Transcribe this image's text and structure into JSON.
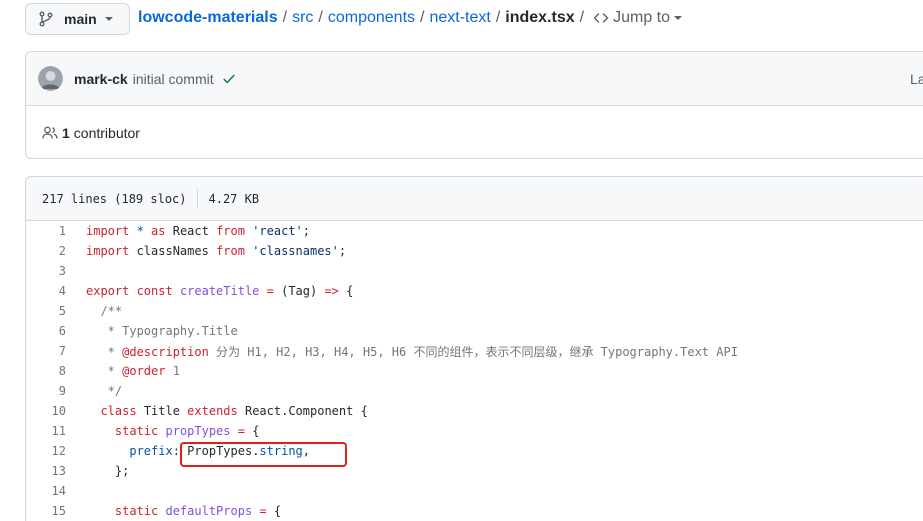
{
  "branch": {
    "label": "main",
    "icon": "git-branch-icon"
  },
  "breadcrumb": {
    "repo": "lowcode-materials",
    "parts": [
      "src",
      "components",
      "next-text"
    ],
    "file": "index.tsx",
    "separator": "/",
    "jump_label": "Jump to"
  },
  "commit": {
    "author": "mark-ck",
    "message": "initial commit",
    "status": "success",
    "latest_label": "La"
  },
  "contributors": {
    "count": "1",
    "label": "contributor"
  },
  "file_info": {
    "lines": "217 lines (189 sloc)",
    "size": "4.27 KB"
  },
  "code_lines": [
    {
      "n": "1",
      "t": [
        [
          "kw",
          "import "
        ],
        [
          "cst",
          "* "
        ],
        [
          "kw",
          "as "
        ],
        [
          "",
          "React "
        ],
        [
          "kw",
          "from "
        ],
        [
          "str",
          "'react'"
        ],
        [
          "",
          ";"
        ]
      ]
    },
    {
      "n": "2",
      "t": [
        [
          "kw",
          "import "
        ],
        [
          "",
          "classNames "
        ],
        [
          "kw",
          "from "
        ],
        [
          "str",
          "'classnames'"
        ],
        [
          "",
          ";"
        ]
      ]
    },
    {
      "n": "3",
      "t": []
    },
    {
      "n": "4",
      "t": [
        [
          "kw",
          "export "
        ],
        [
          "kw",
          "const "
        ],
        [
          "fn",
          "createTitle "
        ],
        [
          "kw",
          "= "
        ],
        [
          "",
          "(Tag) "
        ],
        [
          "kw",
          "=> "
        ],
        [
          "",
          "{"
        ]
      ]
    },
    {
      "n": "5",
      "t": [
        [
          "cm",
          "  /**"
        ]
      ]
    },
    {
      "n": "6",
      "t": [
        [
          "cm",
          "   * Typography.Title"
        ]
      ]
    },
    {
      "n": "7",
      "t": [
        [
          "cm",
          "   * "
        ],
        [
          "at",
          "@description "
        ],
        [
          "cm",
          "分为 H1, H2, H3, H4, H5, H6 不同的组件，表示不同层级，继承 Typography.Text API"
        ]
      ]
    },
    {
      "n": "8",
      "t": [
        [
          "cm",
          "   * "
        ],
        [
          "at",
          "@order "
        ],
        [
          "cm",
          "1"
        ]
      ]
    },
    {
      "n": "9",
      "t": [
        [
          "cm",
          "   */"
        ]
      ]
    },
    {
      "n": "10",
      "t": [
        [
          "",
          "  "
        ],
        [
          "kw",
          "class "
        ],
        [
          "",
          "Title "
        ],
        [
          "kw",
          "extends "
        ],
        [
          "",
          "React.Component {"
        ]
      ]
    },
    {
      "n": "11",
      "t": [
        [
          "",
          "    "
        ],
        [
          "kw",
          "static "
        ],
        [
          "fn",
          "propTypes "
        ],
        [
          "kw",
          "= "
        ],
        [
          "",
          "{"
        ]
      ]
    },
    {
      "n": "12",
      "t": [
        [
          "",
          "      "
        ],
        [
          "cst",
          "prefix"
        ],
        [
          "",
          ": PropTypes."
        ],
        [
          "cst",
          "string"
        ],
        [
          "",
          ","
        ]
      ]
    },
    {
      "n": "13",
      "t": [
        [
          "",
          "    };"
        ]
      ]
    },
    {
      "n": "14",
      "t": []
    },
    {
      "n": "15",
      "t": [
        [
          "",
          "    "
        ],
        [
          "kw",
          "static "
        ],
        [
          "fn",
          "defaultProps "
        ],
        [
          "kw",
          "= "
        ],
        [
          "",
          "{"
        ]
      ]
    }
  ],
  "colors": {
    "link": "#0969da",
    "keyword": "#cf222e",
    "string": "#0a3069",
    "function": "#8250df",
    "comment": "#6e7781",
    "constant": "#0550ae",
    "highlight_box": "#e0201a",
    "success": "#1a7f37"
  }
}
